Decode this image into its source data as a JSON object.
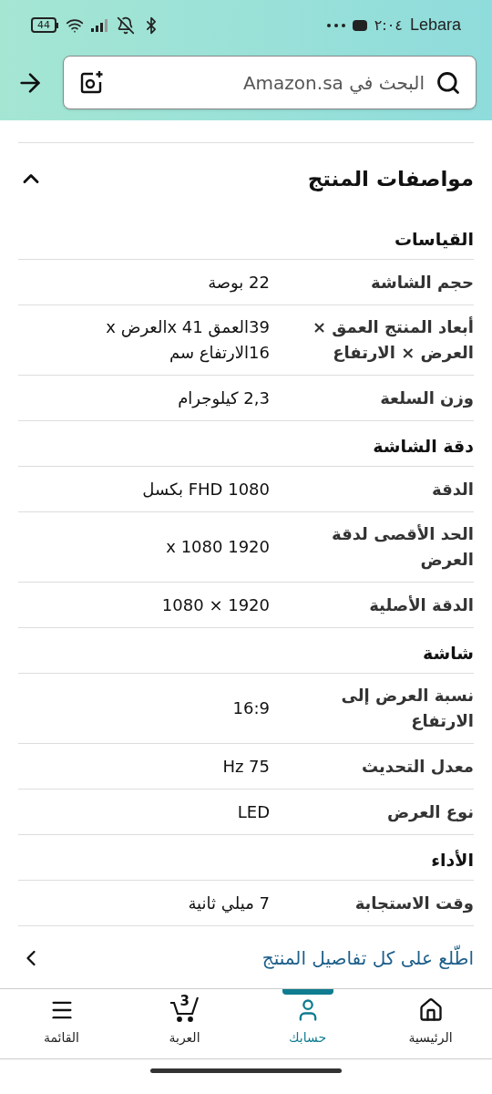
{
  "status_bar": {
    "carrier": "Lebara",
    "time": "٢:٠٤",
    "battery": "44"
  },
  "search": {
    "placeholder": "البحث في Amazon.sa"
  },
  "section": {
    "title": "مواصفات المنتج",
    "expanded": true
  },
  "groups": [
    {
      "title": "القياسات",
      "rows": [
        {
          "label": "حجم الشاشة",
          "value": "22 بوصة"
        },
        {
          "label": "أبعاد المنتج العمق × العرض × الارتفاع",
          "value": "39العمق x 41العرض x 16الارتفاع سم"
        },
        {
          "label": "وزن السلعة",
          "value": "2,3 كيلوجرام"
        }
      ]
    },
    {
      "title": "دقة الشاشة",
      "rows": [
        {
          "label": "الدقة",
          "value": "FHD 1080 بكسل"
        },
        {
          "label": "الحد الأقصى لدقة العرض",
          "value": "1920 x 1080"
        },
        {
          "label": "الدقة الأصلية",
          "value": "1920 × 1080"
        }
      ]
    },
    {
      "title": "شاشة",
      "rows": [
        {
          "label": "نسبة العرض إلى الارتفاع",
          "value": "16:9"
        },
        {
          "label": "معدل التحديث",
          "value": "75 Hz"
        },
        {
          "label": "نوع العرض",
          "value": "LED"
        }
      ]
    },
    {
      "title": "الأداء",
      "rows": [
        {
          "label": "وقت الاستجابة",
          "value": "7 ميلي ثانية"
        }
      ]
    }
  ],
  "details_link": "اطّلع على كل تفاصيل المنتج",
  "nav": [
    {
      "kind": "home",
      "label": "الرئيسية",
      "selected": false
    },
    {
      "kind": "account",
      "label": "حسابك",
      "selected": true
    },
    {
      "kind": "cart",
      "label": "العربة",
      "badge": "3",
      "selected": false
    },
    {
      "kind": "menu",
      "label": "القائمة",
      "selected": false
    }
  ]
}
